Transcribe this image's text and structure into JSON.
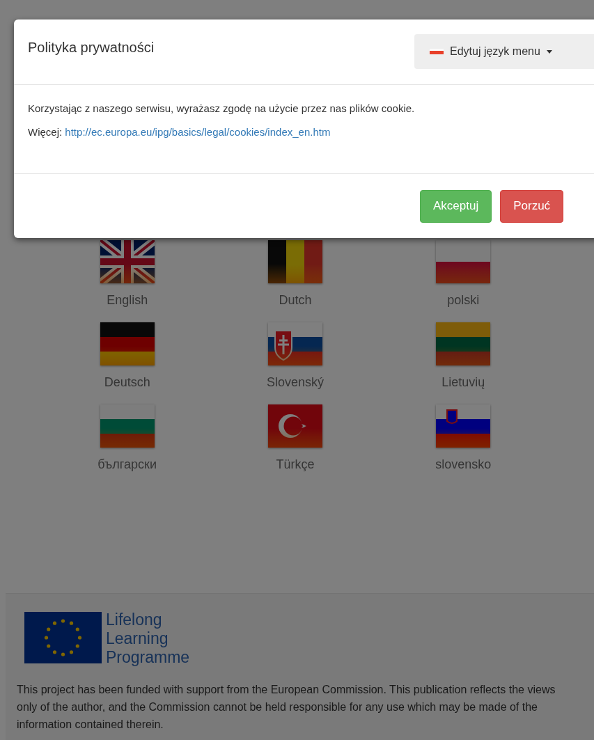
{
  "modal": {
    "title": "Polityka prywatności",
    "language_menu": {
      "label": "Edytuj język menu"
    },
    "message": "Korzystając z naszego serwisu, wyrażasz zgodę na użycie przez nas plików cookie.",
    "more_label": "Więcej:",
    "link": "http://ec.europa.eu/ipg/basics/legal/cookies/index_en.htm",
    "buttons": [
      {
        "label": "Akceptuj",
        "kind": "accept"
      },
      {
        "label": "Porzuć",
        "kind": "dismiss"
      }
    ]
  },
  "languages": [
    {
      "label": "English"
    },
    {
      "label": "Dutch"
    },
    {
      "label": "polski"
    },
    {
      "label": "Deutsch"
    },
    {
      "label": "Slovenský"
    },
    {
      "label": "Lietuvių"
    },
    {
      "label": "български"
    },
    {
      "label": "Türkçe"
    },
    {
      "label": "slovensko"
    }
  ],
  "footer": {
    "programme_lines": [
      "Lifelong",
      "Learning",
      "Programme"
    ],
    "disclaimer": "This project has been funded with support from the European Commission. This publication reflects the views only of the author, and the Commission cannot be held responsible for any use which may be made of the information contained therein."
  }
}
